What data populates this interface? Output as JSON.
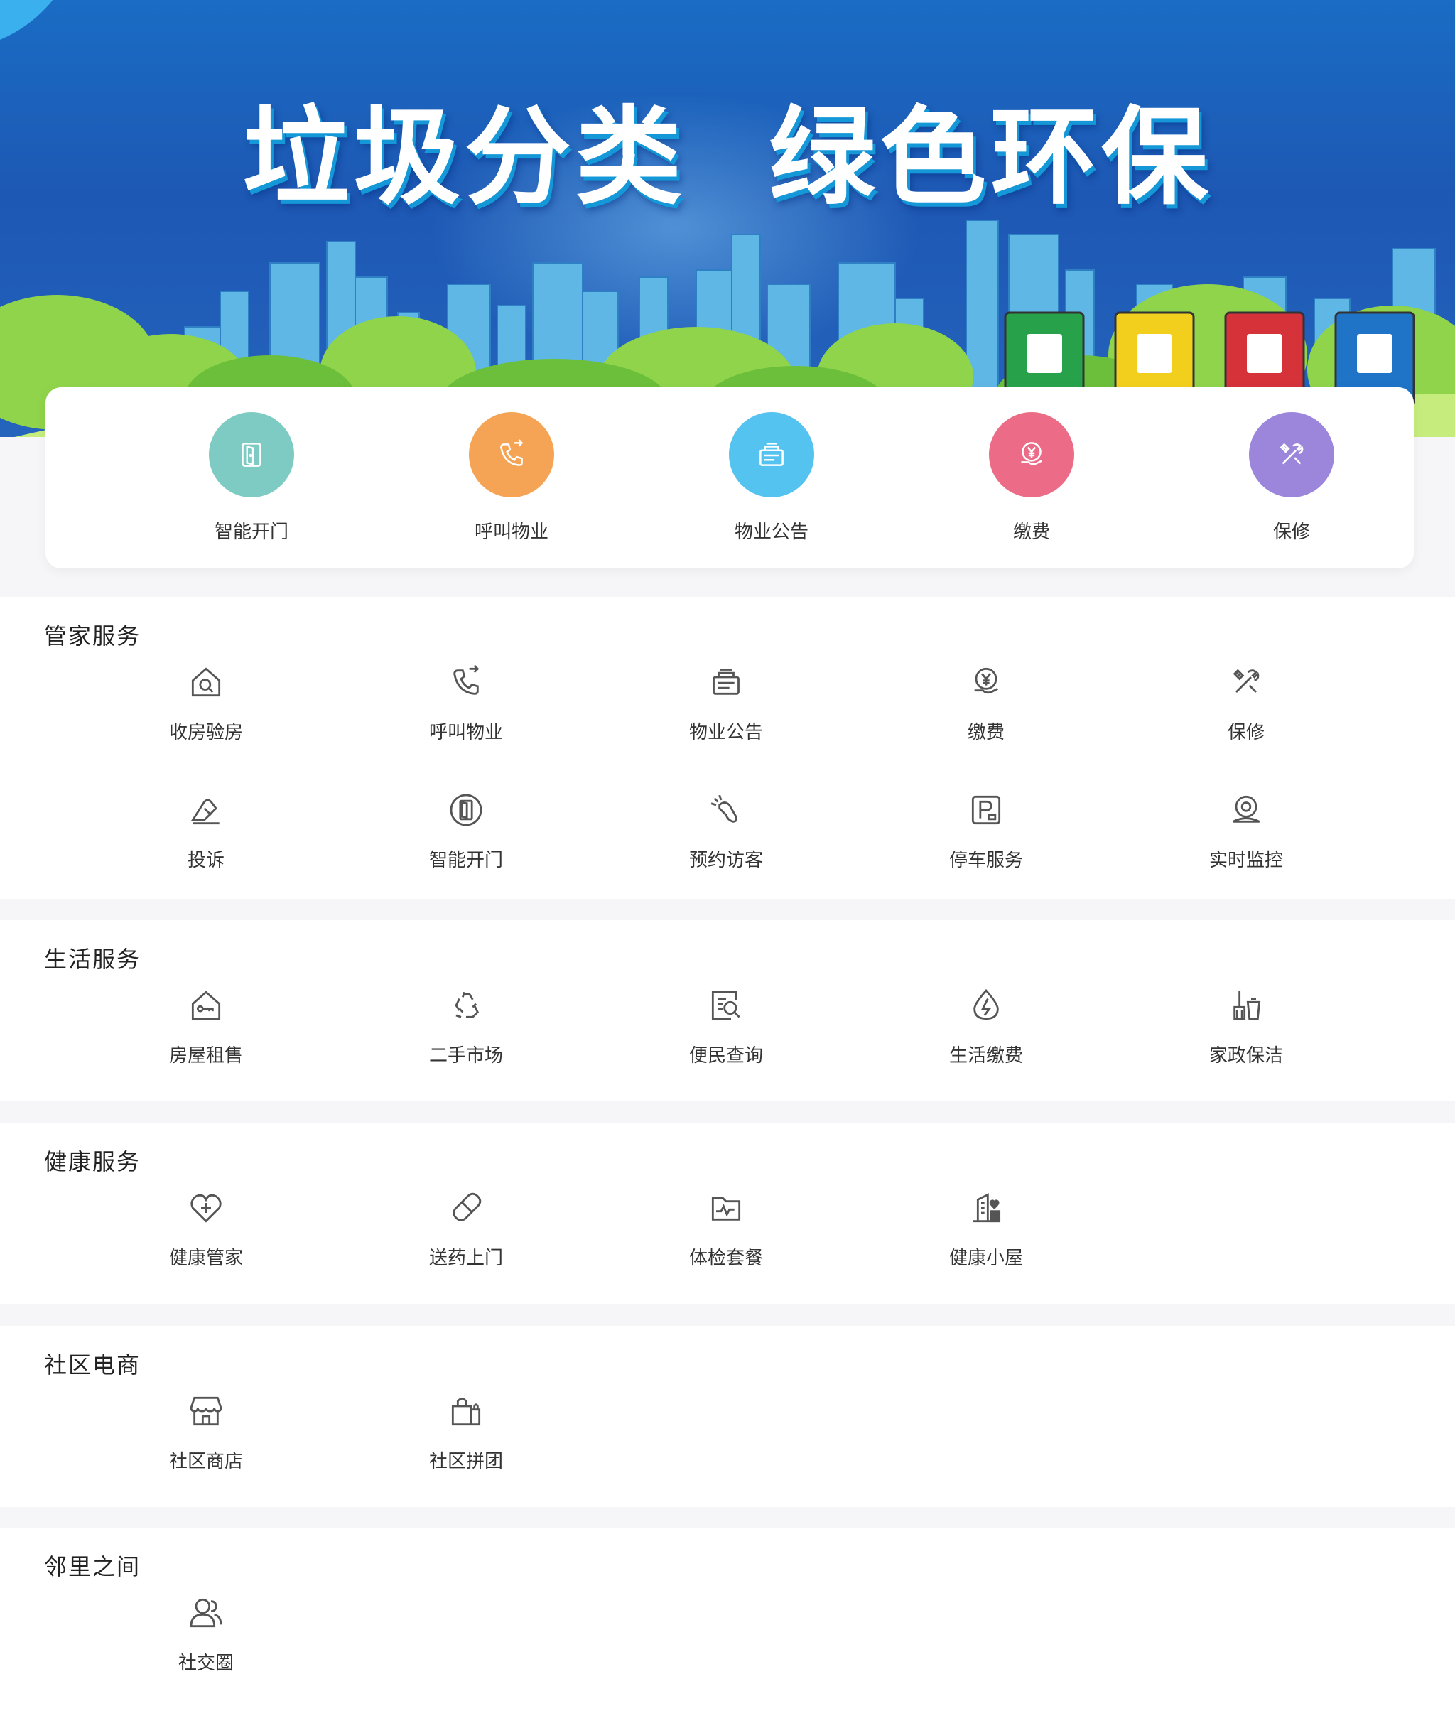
{
  "banner": {
    "title": "垃圾分类  绿色环保"
  },
  "quick_actions": [
    {
      "label": "智能开门",
      "icon": "door-icon",
      "color": "#7ecbc4"
    },
    {
      "label": "呼叫物业",
      "icon": "phone-call-icon",
      "color": "#f5a354"
    },
    {
      "label": "物业公告",
      "icon": "notice-icon",
      "color": "#55c3f0"
    },
    {
      "label": "缴费",
      "icon": "payment-icon",
      "color": "#ec6c87"
    },
    {
      "label": "保修",
      "icon": "repair-icon",
      "color": "#9b86dc"
    }
  ],
  "sections": [
    {
      "title": "管家服务",
      "items": [
        {
          "label": "收房验房",
          "icon": "house-search-icon"
        },
        {
          "label": "呼叫物业",
          "icon": "phone-call-icon"
        },
        {
          "label": "物业公告",
          "icon": "notice-icon"
        },
        {
          "label": "缴费",
          "icon": "payment-icon"
        },
        {
          "label": "保修",
          "icon": "repair-icon"
        },
        {
          "label": "投诉",
          "icon": "complaint-icon"
        },
        {
          "label": "智能开门",
          "icon": "door-icon"
        },
        {
          "label": "预约访客",
          "icon": "visitor-icon"
        },
        {
          "label": "停车服务",
          "icon": "parking-icon"
        },
        {
          "label": "实时监控",
          "icon": "camera-icon"
        }
      ]
    },
    {
      "title": "生活服务",
      "items": [
        {
          "label": "房屋租售",
          "icon": "house-key-icon"
        },
        {
          "label": "二手市场",
          "icon": "recycle-icon"
        },
        {
          "label": "便民查询",
          "icon": "search-doc-icon"
        },
        {
          "label": "生活缴费",
          "icon": "utility-bill-icon"
        },
        {
          "label": "家政保洁",
          "icon": "cleaning-icon"
        }
      ]
    },
    {
      "title": "健康服务",
      "items": [
        {
          "label": "健康管家",
          "icon": "heart-plus-icon"
        },
        {
          "label": "送药上门",
          "icon": "pill-icon"
        },
        {
          "label": "体检套餐",
          "icon": "health-check-icon"
        },
        {
          "label": "健康小屋",
          "icon": "clinic-icon"
        }
      ]
    },
    {
      "title": "社区电商",
      "items": [
        {
          "label": "社区商店",
          "icon": "store-icon"
        },
        {
          "label": "社区拼团",
          "icon": "shopping-bag-icon"
        }
      ]
    },
    {
      "title": "邻里之间",
      "items": [
        {
          "label": "社交圈",
          "icon": "users-icon"
        }
      ]
    }
  ]
}
